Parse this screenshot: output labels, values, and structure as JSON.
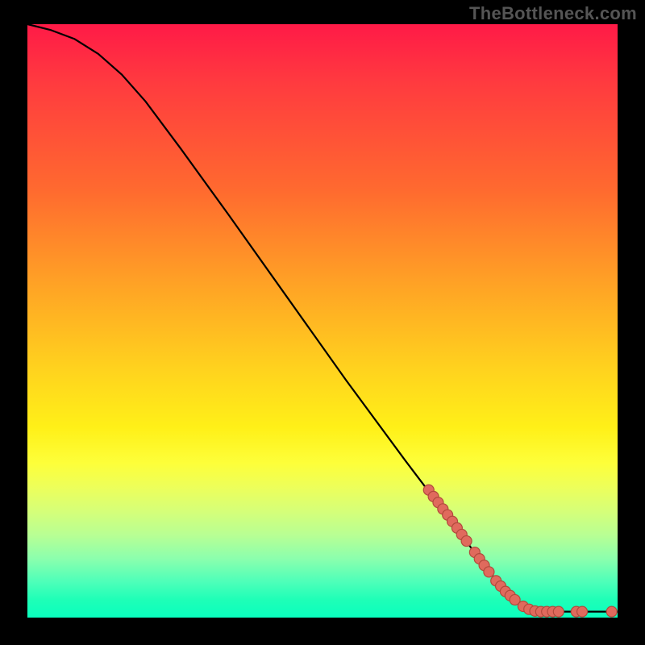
{
  "watermark": "TheBottleneck.com",
  "chart_data": {
    "type": "line",
    "title": "",
    "xlabel": "",
    "ylabel": "",
    "xlim": [
      0,
      100
    ],
    "ylim": [
      0,
      100
    ],
    "curve": [
      {
        "x": 0,
        "y": 100
      },
      {
        "x": 4,
        "y": 99
      },
      {
        "x": 8,
        "y": 97.5
      },
      {
        "x": 12,
        "y": 95
      },
      {
        "x": 16,
        "y": 91.5
      },
      {
        "x": 20,
        "y": 87
      },
      {
        "x": 26,
        "y": 79
      },
      {
        "x": 34,
        "y": 68
      },
      {
        "x": 44,
        "y": 54
      },
      {
        "x": 54,
        "y": 40
      },
      {
        "x": 64,
        "y": 26.5
      },
      {
        "x": 72,
        "y": 16
      },
      {
        "x": 78,
        "y": 8
      },
      {
        "x": 82,
        "y": 3.5
      },
      {
        "x": 85,
        "y": 1.5
      },
      {
        "x": 88,
        "y": 1
      },
      {
        "x": 100,
        "y": 1
      }
    ],
    "markers": [
      {
        "x": 68.0,
        "y": 21.5
      },
      {
        "x": 68.8,
        "y": 20.4
      },
      {
        "x": 69.6,
        "y": 19.4
      },
      {
        "x": 70.4,
        "y": 18.3
      },
      {
        "x": 71.2,
        "y": 17.3
      },
      {
        "x": 72.0,
        "y": 16.2
      },
      {
        "x": 72.8,
        "y": 15.1
      },
      {
        "x": 73.6,
        "y": 14.0
      },
      {
        "x": 74.4,
        "y": 12.9
      },
      {
        "x": 75.8,
        "y": 11.0
      },
      {
        "x": 76.6,
        "y": 9.9
      },
      {
        "x": 77.4,
        "y": 8.8
      },
      {
        "x": 78.2,
        "y": 7.7
      },
      {
        "x": 79.4,
        "y": 6.2
      },
      {
        "x": 80.2,
        "y": 5.3
      },
      {
        "x": 81.0,
        "y": 4.4
      },
      {
        "x": 81.8,
        "y": 3.7
      },
      {
        "x": 82.6,
        "y": 3.0
      },
      {
        "x": 84.0,
        "y": 1.9
      },
      {
        "x": 85.0,
        "y": 1.4
      },
      {
        "x": 86.0,
        "y": 1.1
      },
      {
        "x": 87.0,
        "y": 1.0
      },
      {
        "x": 88.0,
        "y": 1.0
      },
      {
        "x": 89.0,
        "y": 1.0
      },
      {
        "x": 90.0,
        "y": 1.0
      },
      {
        "x": 93.0,
        "y": 1.0
      },
      {
        "x": 94.0,
        "y": 1.0
      },
      {
        "x": 99.0,
        "y": 1.0
      }
    ],
    "background": {
      "type": "vertical-gradient",
      "stops": [
        {
          "pos": 0.0,
          "color": "#ff1a47"
        },
        {
          "pos": 0.28,
          "color": "#ff6a2f"
        },
        {
          "pos": 0.58,
          "color": "#ffd21e"
        },
        {
          "pos": 0.78,
          "color": "#edff5a"
        },
        {
          "pos": 0.94,
          "color": "#4dffb9"
        },
        {
          "pos": 1.0,
          "color": "#0affbe"
        }
      ]
    }
  }
}
